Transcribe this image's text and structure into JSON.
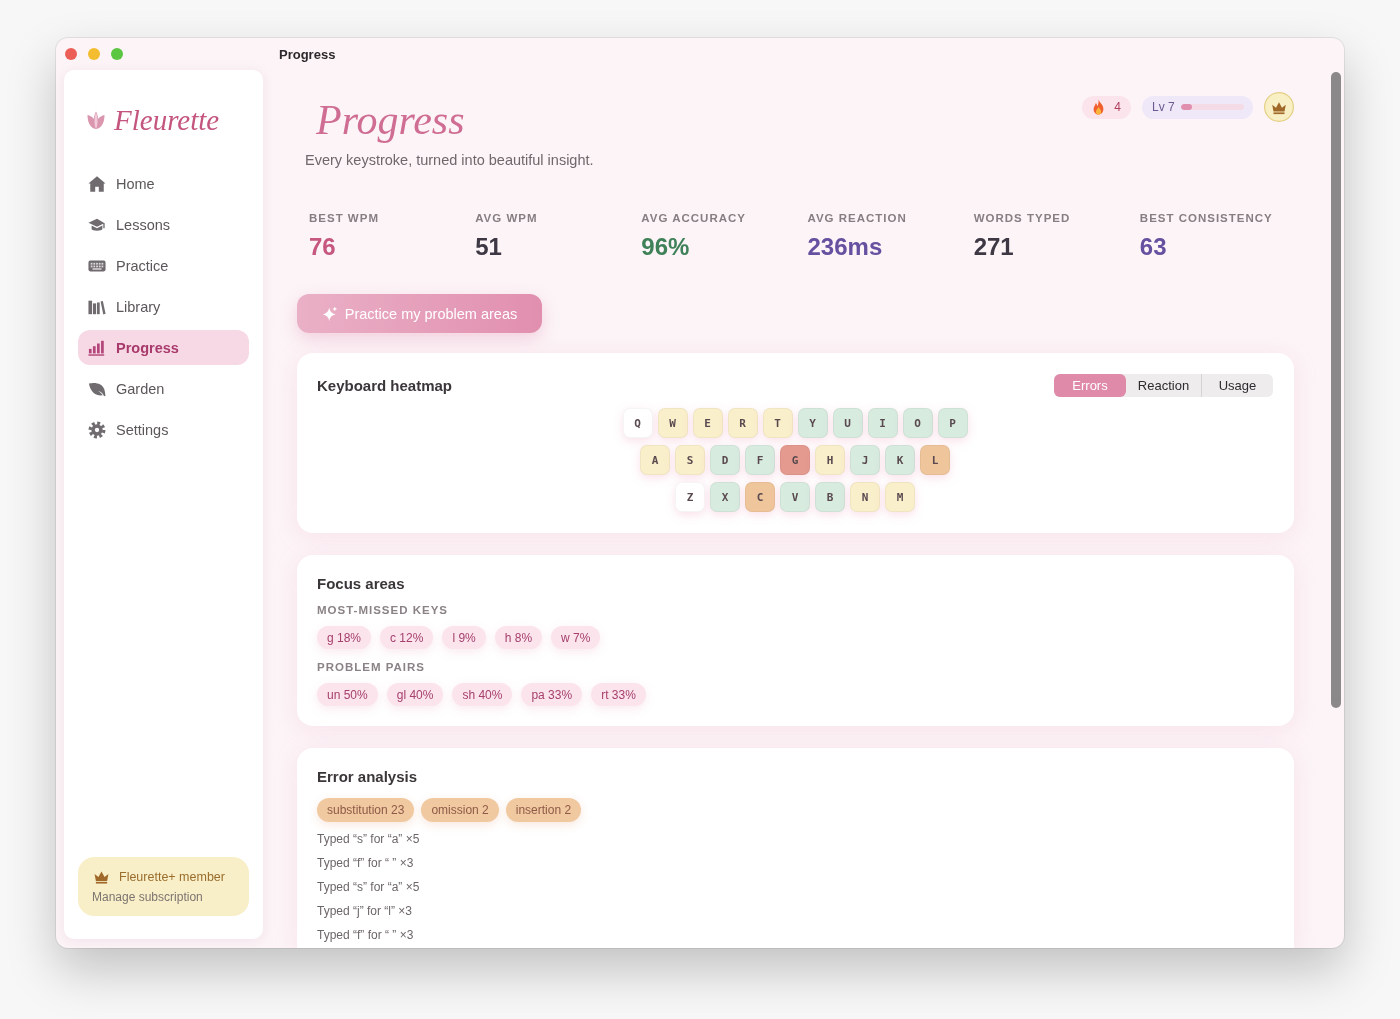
{
  "window": {
    "title": "Progress"
  },
  "sidebar": {
    "logo": "Fleurette",
    "items": [
      {
        "label": "Home",
        "selected": false
      },
      {
        "label": "Lessons",
        "selected": false
      },
      {
        "label": "Practice",
        "selected": false
      },
      {
        "label": "Library",
        "selected": false
      },
      {
        "label": "Progress",
        "selected": true
      },
      {
        "label": "Garden",
        "selected": false
      },
      {
        "label": "Settings",
        "selected": false
      }
    ],
    "membership": {
      "title": "Fleurette+ member",
      "link": "Manage subscription"
    }
  },
  "header": {
    "title": "Progress",
    "subtitle": "Every keystroke, turned into beautiful insight.",
    "streak": "4",
    "level": {
      "label": "Lv 7",
      "level": 0.18
    }
  },
  "stats": [
    {
      "label": "BEST WPM",
      "value": "76",
      "color": "#c6577f"
    },
    {
      "label": "AVG WPM",
      "value": "51",
      "color": "#3d3843"
    },
    {
      "label": "AVG ACCURACY",
      "value": "96%",
      "color": "#3f8158"
    },
    {
      "label": "AVG REACTION",
      "value": "236ms",
      "color": "#6650a0"
    },
    {
      "label": "WORDS TYPED",
      "value": "271",
      "color": "#3d3843"
    },
    {
      "label": "BEST CONSISTENCY",
      "value": "63",
      "color": "#6650a0"
    }
  ],
  "action_button": {
    "label": "Practice my problem areas"
  },
  "heatmap": {
    "title": "Keyboard heatmap",
    "modes": [
      {
        "label": "Errors",
        "selected": true
      },
      {
        "label": "Reaction",
        "selected": false
      },
      {
        "label": "Usage",
        "selected": false
      }
    ],
    "rows": [
      {
        "keys": [
          {
            "key": "Q",
            "color": "#ffffff"
          },
          {
            "key": "W",
            "color": "#f9efca"
          },
          {
            "key": "E",
            "color": "#f9efca"
          },
          {
            "key": "R",
            "color": "#f9efca"
          },
          {
            "key": "T",
            "color": "#f9efca"
          },
          {
            "key": "Y",
            "color": "#d7ebdf"
          },
          {
            "key": "U",
            "color": "#d7ebdf"
          },
          {
            "key": "I",
            "color": "#d7ebdf"
          },
          {
            "key": "O",
            "color": "#d7ebdf"
          },
          {
            "key": "P",
            "color": "#d7ebdf"
          }
        ]
      },
      {
        "keys": [
          {
            "key": "A",
            "color": "#f9efca"
          },
          {
            "key": "S",
            "color": "#f9efca"
          },
          {
            "key": "D",
            "color": "#d7ebdf"
          },
          {
            "key": "F",
            "color": "#d7ebdf"
          },
          {
            "key": "G",
            "color": "#e49a8f"
          },
          {
            "key": "H",
            "color": "#f9efca"
          },
          {
            "key": "J",
            "color": "#d7ebdf"
          },
          {
            "key": "K",
            "color": "#d7ebdf"
          },
          {
            "key": "L",
            "color": "#efc59b"
          }
        ]
      },
      {
        "keys": [
          {
            "key": "Z",
            "color": "#ffffff"
          },
          {
            "key": "X",
            "color": "#d7ebdf"
          },
          {
            "key": "C",
            "color": "#efc59b"
          },
          {
            "key": "V",
            "color": "#d7ebdf"
          },
          {
            "key": "B",
            "color": "#d7ebdf"
          },
          {
            "key": "N",
            "color": "#f9efca"
          },
          {
            "key": "M",
            "color": "#f9efca"
          }
        ]
      }
    ]
  },
  "focus_areas": {
    "title": "Focus areas",
    "groups": [
      {
        "label": "MOST-MISSED KEYS",
        "items": [
          "g 18%",
          "c 12%",
          "l 9%",
          "h 8%",
          "w 7%"
        ]
      },
      {
        "label": "PROBLEM PAIRS",
        "items": [
          "un 50%",
          "gl 40%",
          "sh 40%",
          "pa 33%",
          "rt 33%"
        ]
      }
    ]
  },
  "error_analysis": {
    "title": "Error analysis",
    "types": [
      "substitution 23",
      "omission 2",
      "insertion 2"
    ],
    "details": [
      "Typed “s” for “a” ×5",
      "Typed “f” for “ ” ×3",
      "Typed “s” for “a” ×5",
      "Typed “j” for “l” ×3",
      "Typed “f” for “ ” ×3"
    ]
  }
}
